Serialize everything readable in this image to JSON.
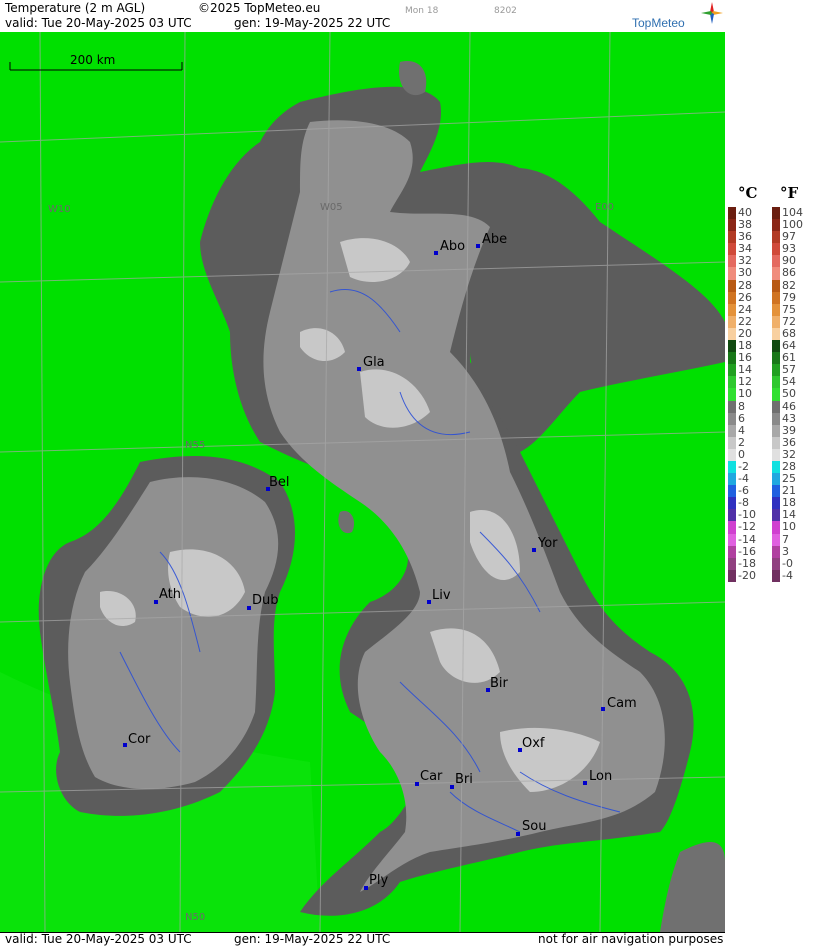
{
  "header": {
    "product": "Temperature (2 m AGL)",
    "copyright": "©2025 TopMeteo.eu",
    "run_day": "Mon 18",
    "code": "8202",
    "valid": "valid:  Tue  20-May-2025  03 UTC",
    "generated": "gen: 19-May-2025 22 UTC"
  },
  "brand": "TopMeteo",
  "footer": {
    "valid": "valid:  Tue  20-May-2025  03 UTC",
    "generated": "gen: 19-May-2025 22 UTC",
    "disclaimer": "not for air navigation purposes"
  },
  "scale_bar": "200 km",
  "grid_labels": [
    "W10",
    "W05",
    "E00",
    "N55",
    "N50"
  ],
  "cities": [
    {
      "code": "Abo"
    },
    {
      "code": "Abe"
    },
    {
      "code": "Gla"
    },
    {
      "code": "Bel"
    },
    {
      "code": "Yor"
    },
    {
      "code": "Ath"
    },
    {
      "code": "Dub"
    },
    {
      "code": "Liv"
    },
    {
      "code": "Bir"
    },
    {
      "code": "Cam"
    },
    {
      "code": "Cor"
    },
    {
      "code": "Oxf"
    },
    {
      "code": "Car"
    },
    {
      "code": "Bri"
    },
    {
      "code": "Lon"
    },
    {
      "code": "Sou"
    },
    {
      "code": "Ply"
    }
  ],
  "legend": {
    "celsius_label": "°C",
    "fahrenheit_label": "°F",
    "celsius": [
      "40",
      "38",
      "36",
      "34",
      "32",
      "30",
      "28",
      "26",
      "24",
      "22",
      "20",
      "18",
      "16",
      "14",
      "12",
      "10",
      "8",
      "6",
      "4",
      "2",
      "0",
      "-2",
      "-4",
      "-6",
      "-8",
      "-10",
      "-12",
      "-14",
      "-16",
      "-18",
      "-20"
    ],
    "fahrenheit": [
      "104",
      "100",
      "97",
      "93",
      "90",
      "86",
      "82",
      "79",
      "75",
      "72",
      "68",
      "64",
      "61",
      "57",
      "54",
      "50",
      "46",
      "43",
      "39",
      "36",
      "32",
      "28",
      "25",
      "21",
      "18",
      "14",
      "10",
      "7",
      "3",
      "-0",
      "-4"
    ],
    "colors": [
      "#6b1e10",
      "#8a2616",
      "#b23a24",
      "#d04a3a",
      "#e46a60",
      "#f08c7c",
      "#b85a14",
      "#d07422",
      "#e4923a",
      "#f0b06a",
      "#f8d0a0",
      "#104a10",
      "#187818",
      "#20a020",
      "#2ec82e",
      "#30e030",
      "#707070",
      "#8a8a8a",
      "#a8a8a8",
      "#c8c8c8",
      "#e0e0e0",
      "#10e0e0",
      "#20a8e0",
      "#2060e0",
      "#3030c0",
      "#5030a8",
      "#d040d0",
      "#e060e0",
      "#b040a0",
      "#904080",
      "#703060"
    ]
  },
  "colors": {
    "sea": "#00e000",
    "land_dark": "#5c5c5c",
    "land_mid": "#909090",
    "land_light": "#c8c8c8",
    "city_marker": "#0000cc"
  }
}
